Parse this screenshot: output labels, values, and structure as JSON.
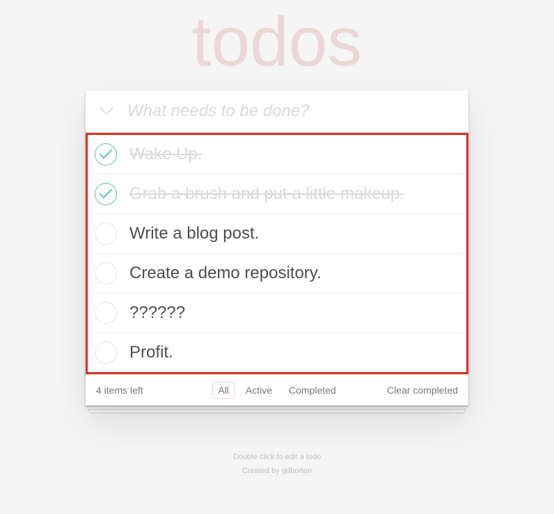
{
  "title": "todos",
  "input": {
    "placeholder": "What needs to be done?"
  },
  "todos": [
    {
      "label": "Wake Up.",
      "completed": true
    },
    {
      "label": "Grab a brush and put a little makeup.",
      "completed": true
    },
    {
      "label": "Write a blog post.",
      "completed": false
    },
    {
      "label": "Create a demo repository.",
      "completed": false
    },
    {
      "label": "??????",
      "completed": false
    },
    {
      "label": "Profit.",
      "completed": false
    }
  ],
  "footer": {
    "count": "4 items left",
    "filters": {
      "all": "All",
      "active": "Active",
      "completed": "Completed"
    },
    "clear": "Clear completed"
  },
  "info": {
    "line1": "Double-click to edit a todo",
    "line2_prefix": "Created by ",
    "author": "gdborton"
  }
}
